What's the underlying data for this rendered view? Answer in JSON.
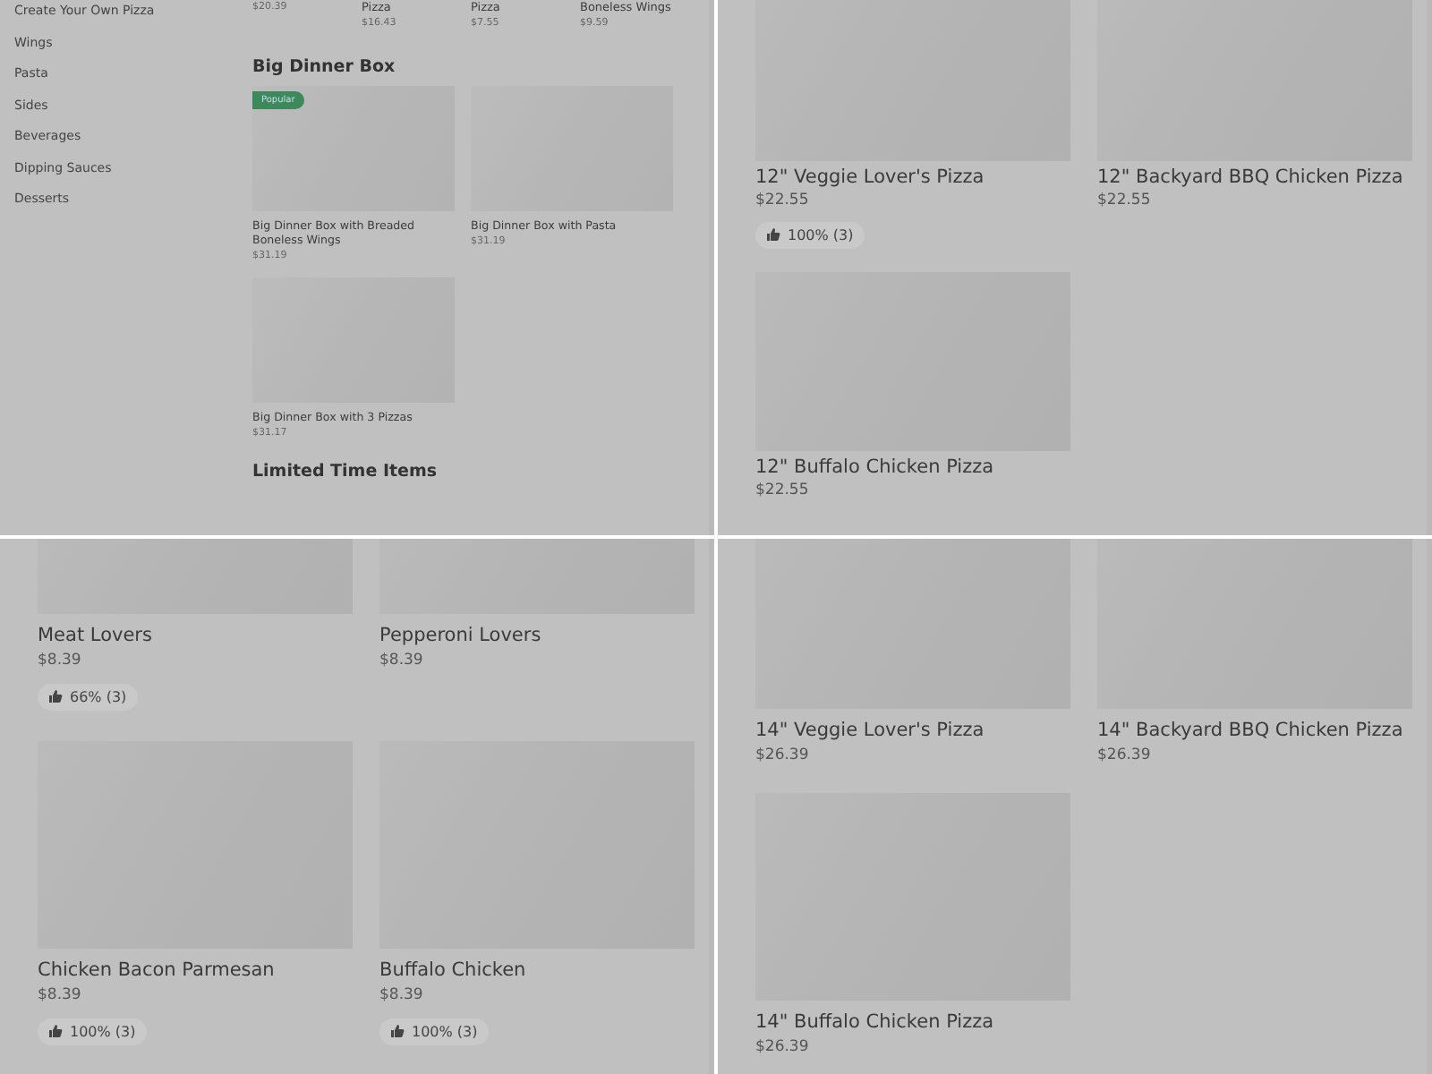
{
  "panels": [
    {
      "kind": "overview",
      "sidebar": {
        "items": [
          "Create Your Own Pizza",
          "Wings",
          "Pasta",
          "Sides",
          "Beverages",
          "Dipping Sauces",
          "Desserts"
        ]
      },
      "sections": [
        {
          "kind": "strip",
          "items": [
            {
              "price": "$20.39"
            },
            {
              "name": "Pizza",
              "price": "$16.43"
            },
            {
              "name": "Pizza",
              "price": "$7.55"
            },
            {
              "name": "Boneless Wings",
              "price": "$9.59"
            }
          ]
        },
        {
          "kind": "grid",
          "title": "Big Dinner Box",
          "items": [
            {
              "name": "Big Dinner Box with Breaded Boneless Wings",
              "price": "$31.19",
              "badge": "Popular"
            },
            {
              "name": "Big Dinner Box with Pasta",
              "price": "$31.19"
            },
            {
              "name": "Big Dinner Box with 3 Pizzas",
              "price": "$31.17"
            }
          ]
        },
        {
          "kind": "heading",
          "title": "Limited Time Items"
        }
      ]
    },
    {
      "kind": "cards",
      "items": [
        {
          "name": "12\" Veggie Lover's Pizza",
          "price": "$22.55",
          "rating": "100% (3)"
        },
        {
          "name": "12\" Backyard BBQ Chicken Pizza",
          "price": "$22.55"
        },
        {
          "name": "12\" Buffalo Chicken Pizza",
          "price": "$22.55"
        }
      ]
    },
    {
      "kind": "cards",
      "items": [
        {
          "name": "Meat Lovers",
          "price": "$8.39",
          "rating": "66% (3)"
        },
        {
          "name": "Pepperoni Lovers",
          "price": "$8.39"
        },
        {
          "name": "Chicken Bacon Parmesan",
          "price": "$8.39",
          "rating": "100% (3)"
        },
        {
          "name": "Buffalo Chicken",
          "price": "$8.39",
          "rating": "100% (3)"
        }
      ]
    },
    {
      "kind": "cards",
      "items": [
        {
          "name": "14\" Veggie Lover's Pizza",
          "price": "$26.39"
        },
        {
          "name": "14\" Backyard BBQ Chicken Pizza",
          "price": "$26.39"
        },
        {
          "name": "14\" Buffalo Chicken Pizza",
          "price": "$26.39"
        }
      ]
    }
  ]
}
